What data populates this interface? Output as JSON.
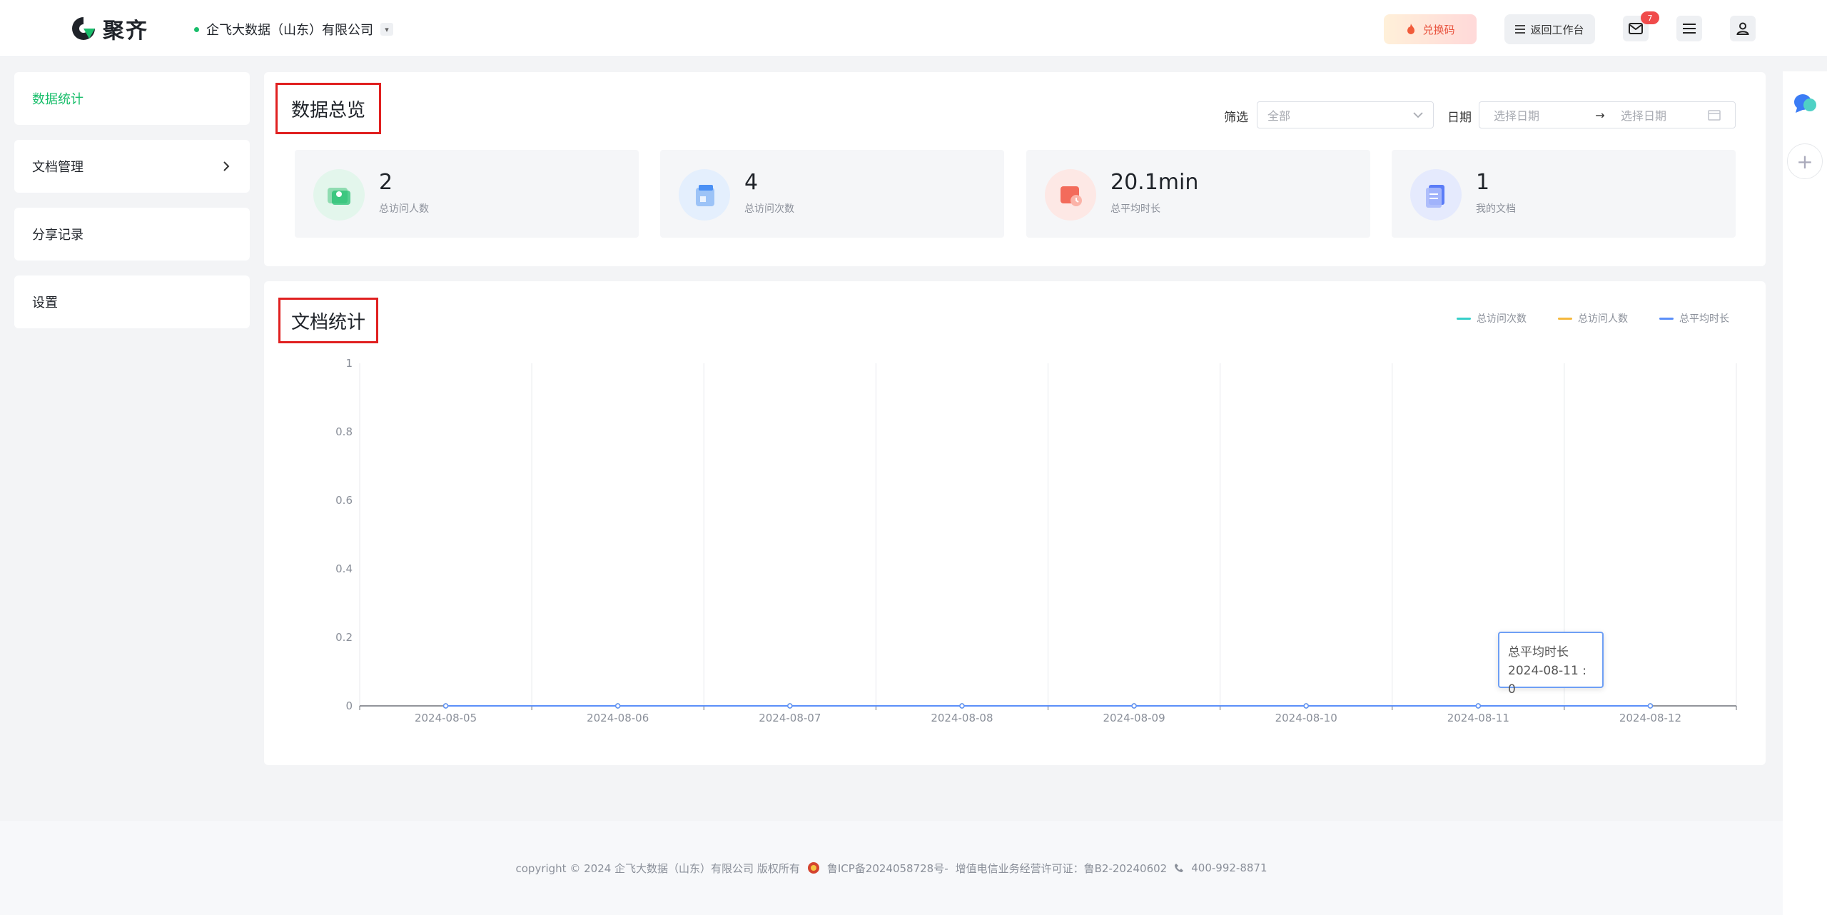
{
  "header": {
    "brand": "聚齐",
    "company": "企飞大数据（山东）有限公司",
    "redeem_label": "兑换码",
    "back_label": "返回工作台",
    "mail_badge": "7"
  },
  "sidebar": {
    "items": [
      {
        "label": "数据统计"
      },
      {
        "label": "文档管理"
      },
      {
        "label": "分享记录"
      },
      {
        "label": "设置"
      }
    ]
  },
  "overview": {
    "title": "数据总览",
    "filter_label": "筛选",
    "filter_value": "全部",
    "date_label": "日期",
    "start_placeholder": "选择日期",
    "end_placeholder": "选择日期",
    "stats": [
      {
        "value": "2",
        "label": "总访问人数",
        "color": "#19be6b"
      },
      {
        "value": "4",
        "label": "总访问次数",
        "color": "#4a90f5"
      },
      {
        "value": "20.1min",
        "label": "总平均时长",
        "color": "#f36b5b"
      },
      {
        "value": "1",
        "label": "我的文档",
        "color": "#5b7cf7"
      }
    ]
  },
  "doc_stats": {
    "title": "文档统计",
    "tooltip_series": "总平均时长",
    "tooltip_value": "2024-08-11 : 0"
  },
  "chart_data": {
    "type": "line",
    "x": [
      "2024-08-05",
      "2024-08-06",
      "2024-08-07",
      "2024-08-08",
      "2024-08-09",
      "2024-08-10",
      "2024-08-11",
      "2024-08-12"
    ],
    "series": [
      {
        "name": "总访问次数",
        "color": "#36cfc9",
        "values": [
          0,
          0,
          0,
          0,
          0,
          0,
          0,
          0
        ]
      },
      {
        "name": "总访问人数",
        "color": "#f5b83d",
        "values": [
          0,
          0,
          0,
          0,
          0,
          0,
          0,
          0
        ]
      },
      {
        "name": "总平均时长",
        "color": "#5b8ff9",
        "values": [
          0,
          0,
          0,
          0,
          0,
          0,
          0,
          0
        ]
      }
    ],
    "y_ticks": [
      "0",
      "0.2",
      "0.4",
      "0.6",
      "0.8",
      "1"
    ],
    "ylim": [
      0,
      1
    ],
    "grid": "vertical",
    "legend": "top-right"
  },
  "footer": {
    "copyright": "copyright © 2024 企飞大数据（山东）有限公司 版权所有",
    "icp": "鲁ICP备2024058728号-",
    "license": "增值电信业务经营许可证：鲁B2-20240602",
    "phone": "400-992-8871"
  }
}
